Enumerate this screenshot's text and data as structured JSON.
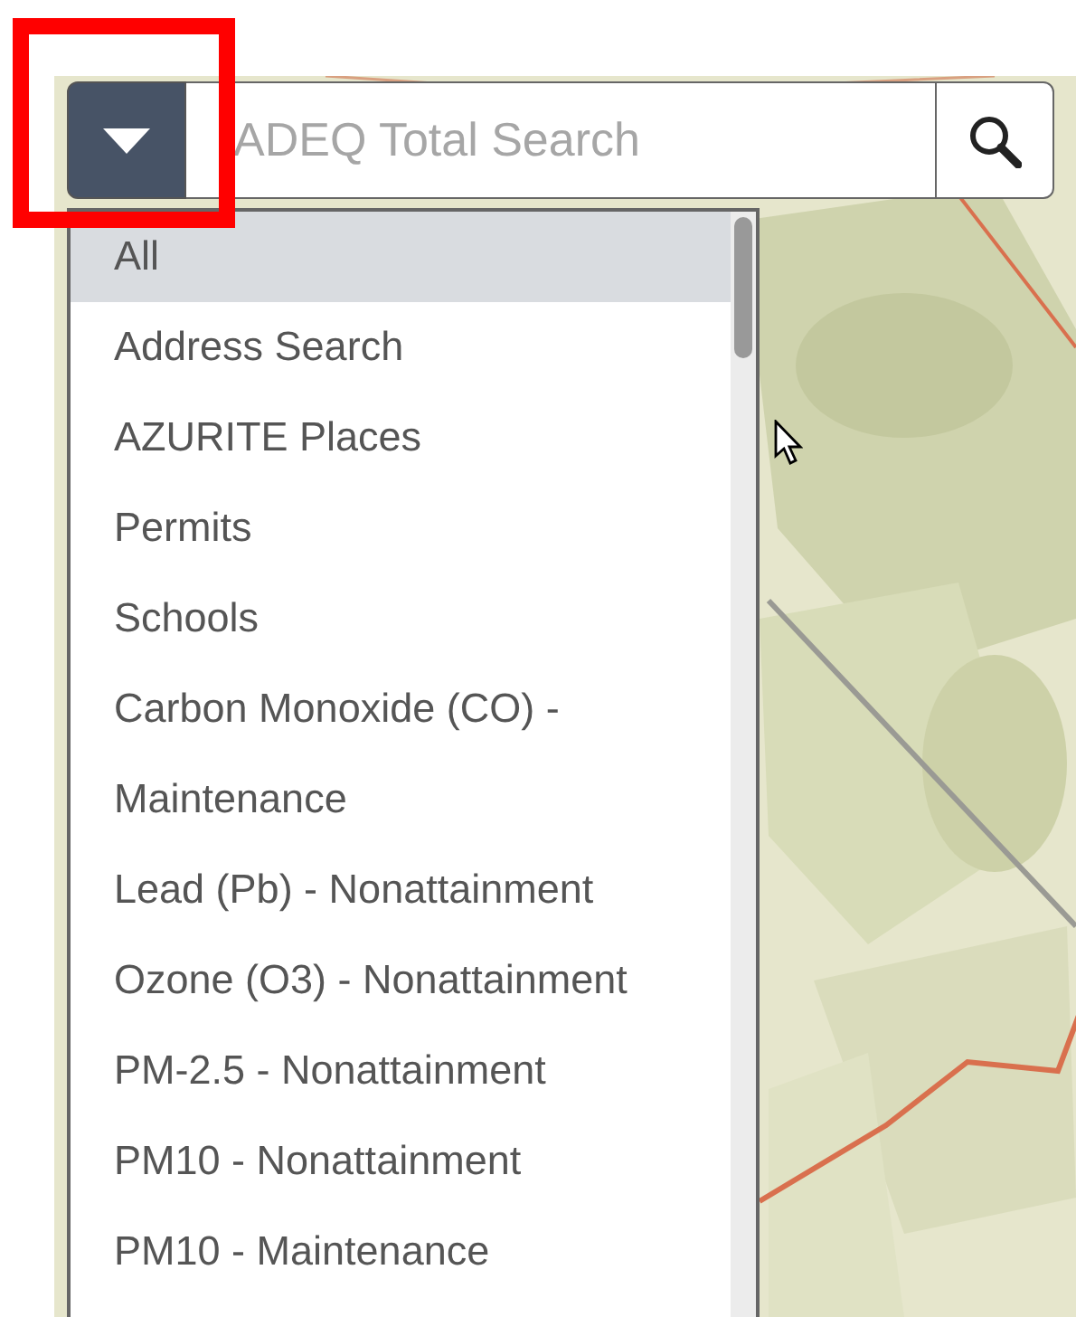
{
  "search": {
    "placeholder": "ADEQ Total Search"
  },
  "dropdown": {
    "items": [
      {
        "label": "All",
        "selected": true
      },
      {
        "label": "Address Search",
        "selected": false
      },
      {
        "label": "AZURITE Places",
        "selected": false
      },
      {
        "label": "Permits",
        "selected": false
      },
      {
        "label": "Schools",
        "selected": false
      },
      {
        "label": "Carbon Monoxide (CO) - Maintenance",
        "selected": false
      },
      {
        "label": "Lead (Pb) - Nonattainment",
        "selected": false
      },
      {
        "label": "Ozone (O3) - Nonattainment",
        "selected": false
      },
      {
        "label": "PM-2.5 - Nonattainment",
        "selected": false
      },
      {
        "label": "PM10 - Nonattainment",
        "selected": false
      },
      {
        "label": "PM10 - Maintenance",
        "selected": false
      }
    ]
  }
}
